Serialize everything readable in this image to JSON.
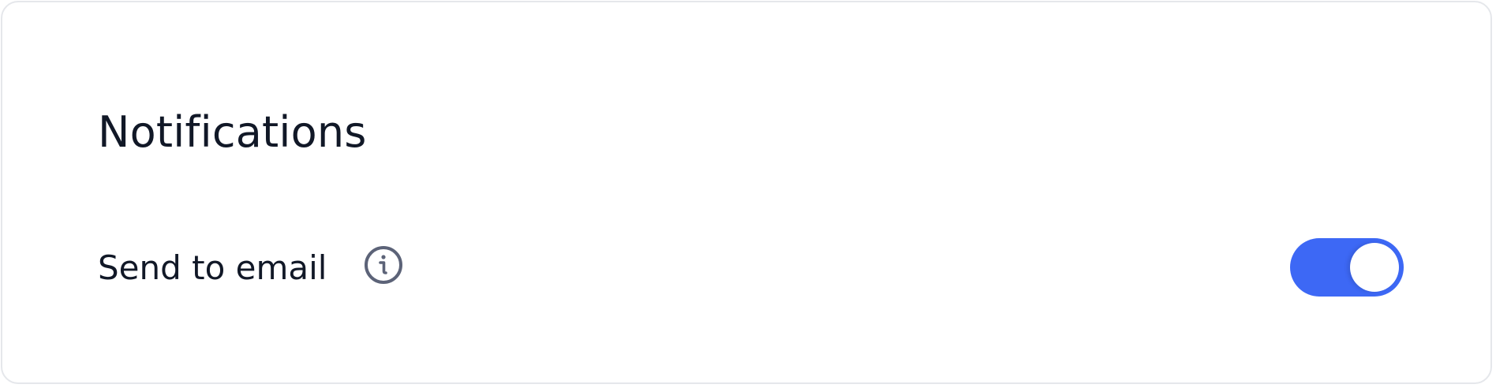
{
  "panel": {
    "title": "Notifications",
    "settings": [
      {
        "label": "Send to email",
        "info_icon": "info-icon",
        "toggle_on": true
      }
    ]
  },
  "colors": {
    "toggle_active": "#3d68f5",
    "text": "#111827",
    "icon": "#5c6378",
    "border": "#e5e7eb"
  }
}
